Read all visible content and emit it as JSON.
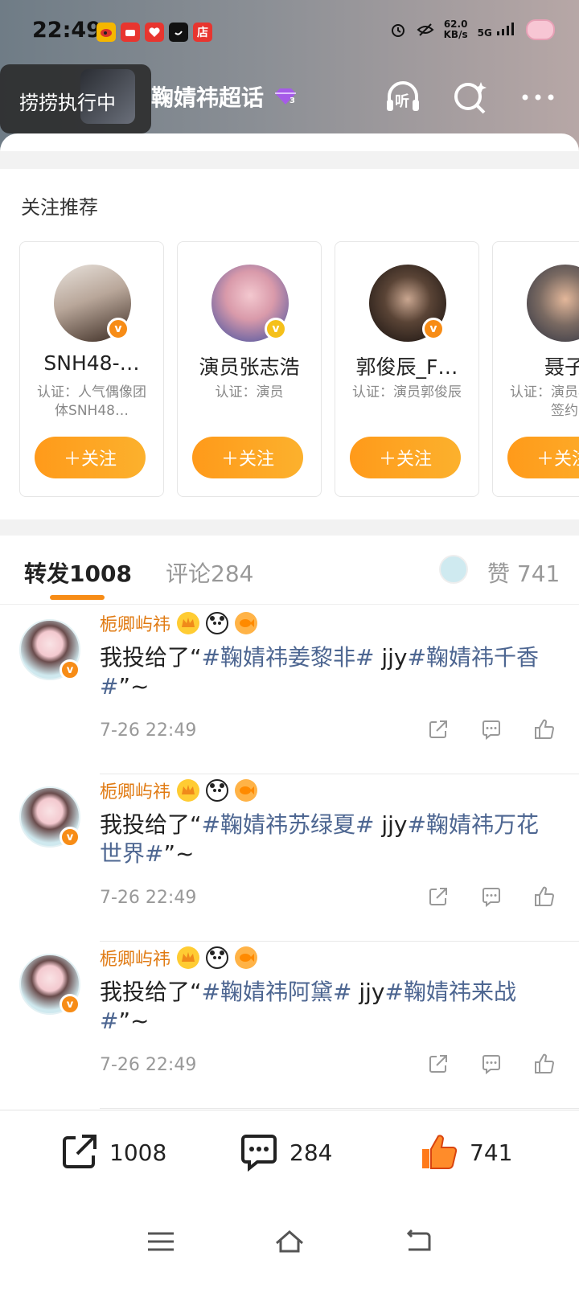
{
  "status_bar": {
    "time": "22:49",
    "net_speed_value": "62.0",
    "net_speed_unit": "KB/s",
    "network": "5G",
    "app_icons": [
      "weibo-icon",
      "mall-icon",
      "heart-app-icon",
      "emoji-app-icon",
      "store-icon"
    ],
    "store_label": "店"
  },
  "header": {
    "task_label": "捞捞执行中",
    "title": "鞠婧祎超话",
    "listen_label": "听",
    "icons": [
      "back-icon",
      "gem-level-icon",
      "listen-icon",
      "search-sparkle-icon",
      "more-icon"
    ]
  },
  "recommend": {
    "title": "关注推荐",
    "follow_label": "＋关注",
    "cards": [
      {
        "name": "SNH48-…",
        "auth": "认证：人气偶像团体SNH48…"
      },
      {
        "name": "演员张志浩",
        "auth": "认证：演员"
      },
      {
        "name": "郭俊辰_F…",
        "auth": "认证：演员郭俊辰"
      },
      {
        "name": "聂子",
        "auth": "认证：演员年娱乐签约"
      }
    ]
  },
  "tabs": {
    "repost": "转发",
    "repost_count": "1008",
    "comment": "评论",
    "comment_count": "284",
    "likes": "赞",
    "likes_count": "741"
  },
  "reposts": [
    {
      "user": "栀卿屿祎",
      "prefix": "我投给了“",
      "topic1": "#鞠婧祎姜黎非#",
      "mid": " jjy",
      "topic2": "#鞠婧祎千香#",
      "suffix": "”~",
      "time": "7-26 22:49"
    },
    {
      "user": "栀卿屿祎",
      "prefix": "我投给了“",
      "topic1": "#鞠婧祎苏绿夏#",
      "mid": " jjy",
      "topic2": "#鞠婧祎万花世界#",
      "suffix": "”~",
      "time": "7-26 22:49"
    },
    {
      "user": "栀卿屿祎",
      "prefix": "我投给了“",
      "topic1": "#鞠婧祎阿黛#",
      "mid": " jjy",
      "topic2": "#鞠婧祎来战#",
      "suffix": "”~",
      "time": "7-26 22:49"
    }
  ],
  "bottom_bar": {
    "repost_count": "1008",
    "comment_count": "284",
    "like_count": "741"
  },
  "colors": {
    "accent": "#f78c16",
    "topic": "#4d6691",
    "username": "#e07a12"
  }
}
